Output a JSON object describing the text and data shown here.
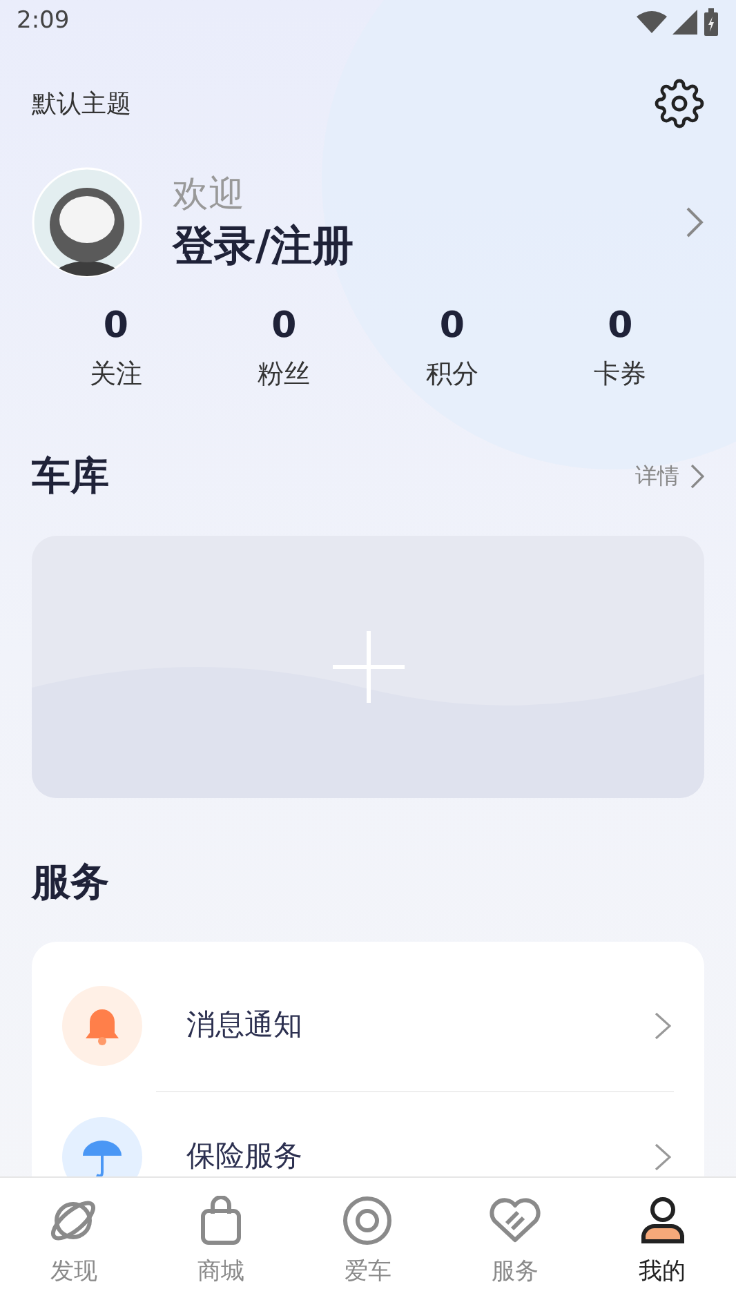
{
  "status_bar": {
    "time": "2:09"
  },
  "header": {
    "theme_label": "默认主题"
  },
  "profile": {
    "greeting": "欢迎",
    "login": "登录/注册"
  },
  "stats": [
    {
      "value": "0",
      "label": "关注"
    },
    {
      "value": "0",
      "label": "粉丝"
    },
    {
      "value": "0",
      "label": "积分"
    },
    {
      "value": "0",
      "label": "卡券"
    }
  ],
  "garage": {
    "title": "车库",
    "details_link": "详情"
  },
  "services": {
    "title": "服务",
    "items": [
      {
        "kind": "bell",
        "label": "消息通知"
      },
      {
        "kind": "umbrella",
        "label": "保险服务"
      }
    ]
  },
  "tab_bar": [
    {
      "kind": "planet",
      "label": "发现",
      "selected": false
    },
    {
      "kind": "bag",
      "label": "商城",
      "selected": false
    },
    {
      "kind": "target",
      "label": "爱车",
      "selected": false
    },
    {
      "kind": "heart",
      "label": "服务",
      "selected": false
    },
    {
      "kind": "person",
      "label": "我的",
      "selected": true
    }
  ]
}
